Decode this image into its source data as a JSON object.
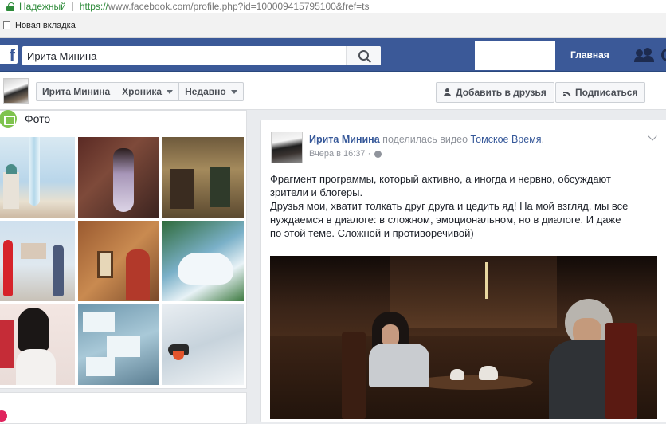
{
  "browser": {
    "secure_label": "Надежный",
    "url_scheme": "https://",
    "url_rest": "www.facebook.com/profile.php?id=100009415795100&fref=ts",
    "bookmark": "Новая вкладка"
  },
  "fb_bar": {
    "logo": "f",
    "search_value": "Ирита Минина",
    "home_label": "Главная"
  },
  "profile_nav": {
    "tabs": [
      {
        "label": "Ирита Минина"
      },
      {
        "label": "Хроника"
      },
      {
        "label": "Недавно"
      }
    ],
    "add_friend": "Добавить в друзья",
    "subscribe": "Подписаться"
  },
  "photos": {
    "title": "Фото"
  },
  "post": {
    "author": "Ирита Минина",
    "action": "поделилась видео",
    "page": "Томское Время",
    "time": "Вчера в 16:37 ·",
    "text_lines": [
      "Фрагмент программы, который активно, а иногда и нервно, обсуждают",
      "зрители и блогеры.",
      "Друзья мои, хватит толкать друг друга и цедить яд! На мой взгляд, мы все",
      "нуждаемся в диалоге: в сложном, эмоциональном, но в диалоге. И даже",
      "по этой теме. Сложной и противоречивой)"
    ]
  },
  "colors": {
    "fb_blue": "#3b5998",
    "link": "#365899",
    "secure_green": "#2e8b3a"
  }
}
